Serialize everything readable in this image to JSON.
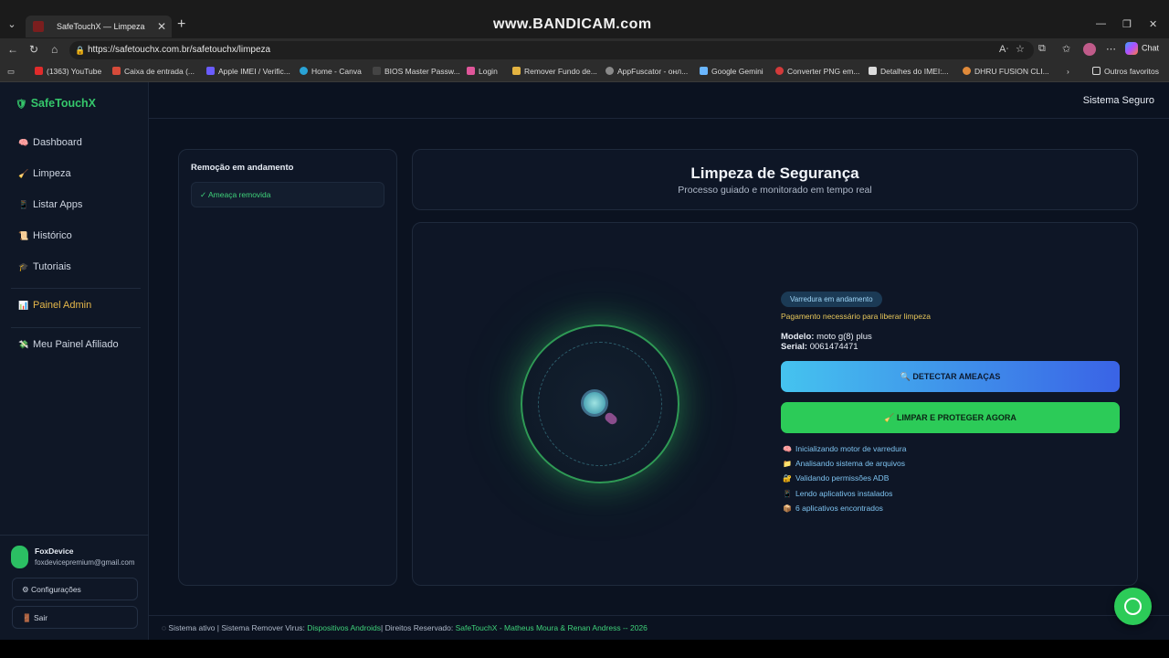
{
  "browser": {
    "watermark": "www.BANDICAM.com",
    "tab_title": "SafeTouchX — Limpeza",
    "url": "https://safetouchx.com.br/safetouchx/limpeza",
    "chat_label": "Chat",
    "bookmarks": [
      "(1363) YouTube",
      "Caixa de entrada (...",
      "Apple IMEI / Verific...",
      "Home - Canva",
      "BIOS Master Passw...",
      "Login",
      "Remover Fundo de...",
      "AppFuscator - онл...",
      "Google Gemini",
      "Converter PNG em...",
      "Detalhes do IMEI:...",
      "DHRU FUSION CLI...",
      "Outros favoritos"
    ]
  },
  "sidebar": {
    "brand": "SafeTouchX",
    "items": [
      {
        "label": "Dashboard",
        "icon": "brain-icon"
      },
      {
        "label": "Limpeza",
        "icon": "broom-icon"
      },
      {
        "label": "Listar Apps",
        "icon": "phone-icon"
      },
      {
        "label": "Histórico",
        "icon": "scroll-icon"
      },
      {
        "label": "Tutoriais",
        "icon": "graduation-cap-icon"
      }
    ],
    "admin": "Painel Admin",
    "affiliate": "Meu Painel Afiliado",
    "user": {
      "name": "FoxDevice",
      "email": "foxdevicepremium@gmail.com"
    },
    "settings": "Configurações",
    "logout": "Sair"
  },
  "header": {
    "status": "Sistema Seguro"
  },
  "removal": {
    "title": "Remoção em andamento",
    "item": "✓ Ameaça removida"
  },
  "main": {
    "title": "Limpeza de Segurança",
    "subtitle": "Processo guiado e monitorado em tempo real",
    "badge": "Varredura em andamento",
    "warning": "Pagamento necessário para liberar limpeza",
    "model_label": "Modelo:",
    "model_value": "moto g(8) plus",
    "serial_label": "Serial:",
    "serial_value": "0061474471",
    "detect_button": "🔍 DETECTAR AMEAÇAS",
    "clean_button": "🧹 LIMPAR E PROTEGER AGORA",
    "log": [
      {
        "icon": "brain-icon",
        "text": "Inicializando motor de varredura"
      },
      {
        "icon": "folder-icon",
        "text": "Analisando sistema de arquivos"
      },
      {
        "icon": "lock-icon",
        "text": "Validando permissões ADB"
      },
      {
        "icon": "phone-icon",
        "text": "Lendo aplicativos instalados"
      },
      {
        "icon": "box-icon",
        "text": "6 aplicativos encontrados"
      }
    ]
  },
  "footer": {
    "prefix": "Sistema ativo | Sistema Remover Virus:",
    "devices": "Dispositivos Androids",
    "rights": "| Direitos Reservado:",
    "credits": "SafeTouchX - Matheus Moura & Renan Andress -- 2026"
  },
  "colors": {
    "accent_green": "#2ccb58",
    "accent_blue": "#3a63e6",
    "background": "#0b1220"
  }
}
